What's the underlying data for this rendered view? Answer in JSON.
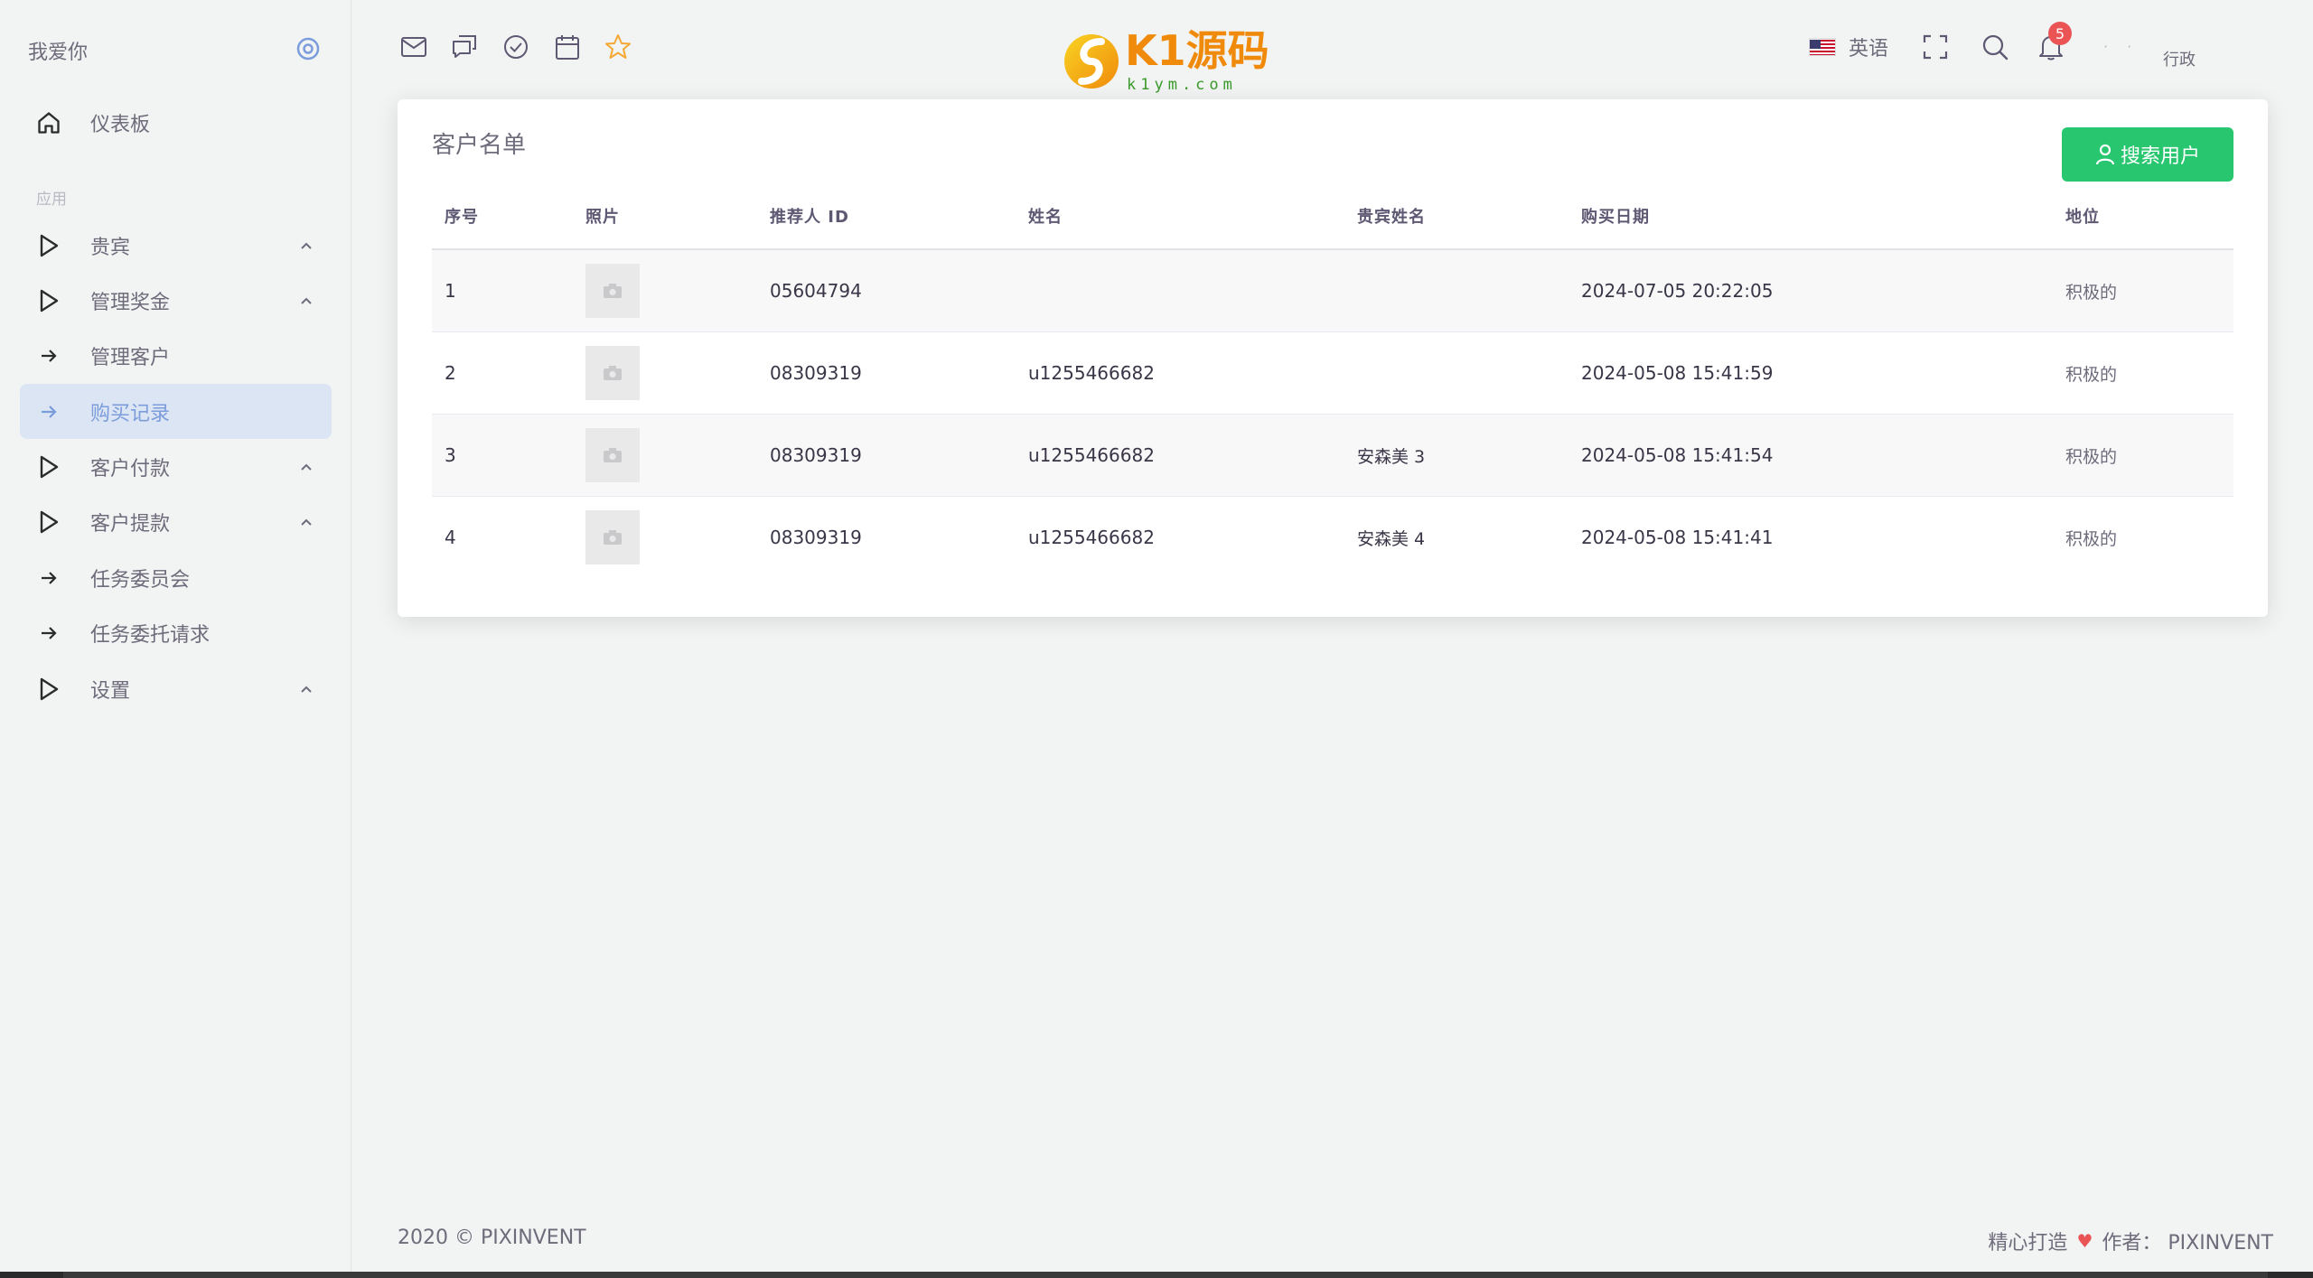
{
  "sidebar": {
    "brand": "我爱你",
    "section_label": "应用",
    "items": [
      {
        "label": "仪表板",
        "icon": "home-icon",
        "chevron": false,
        "active": false
      },
      {
        "label": "贵宾",
        "icon": "play-icon",
        "chevron": true,
        "active": false
      },
      {
        "label": "管理奖金",
        "icon": "play-icon",
        "chevron": true,
        "active": false
      },
      {
        "label": "管理客户",
        "icon": "arrow-right-icon",
        "chevron": false,
        "active": false
      },
      {
        "label": "购买记录",
        "icon": "arrow-right-icon",
        "chevron": false,
        "active": true
      },
      {
        "label": "客户付款",
        "icon": "play-icon",
        "chevron": true,
        "active": false
      },
      {
        "label": "客户提款",
        "icon": "play-icon",
        "chevron": true,
        "active": false
      },
      {
        "label": "任务委员会",
        "icon": "arrow-right-icon",
        "chevron": false,
        "active": false
      },
      {
        "label": "任务委托请求",
        "icon": "arrow-right-icon",
        "chevron": false,
        "active": false
      },
      {
        "label": "设置",
        "icon": "play-icon",
        "chevron": true,
        "active": false
      }
    ]
  },
  "topbar": {
    "icons": [
      "mail-icon",
      "chat-icon",
      "check-circle-icon",
      "calendar-icon",
      "star-icon"
    ],
    "logo": {
      "main": "K1源码",
      "sub": "k1ym.com"
    },
    "language": "英语",
    "notification_count": "5",
    "user_role": "行政",
    "user_dots": "· ·"
  },
  "card": {
    "title": "客户名单",
    "search_button": "搜索用户",
    "columns": [
      "序号",
      "照片",
      "推荐人 ID",
      "姓名",
      "贵宾姓名",
      "购买日期",
      "地位"
    ],
    "rows": [
      {
        "no": "1",
        "referrer_id": "05604794",
        "name": "",
        "vip_name": "",
        "date": "2024-07-05 20:22:05",
        "status": "积极的"
      },
      {
        "no": "2",
        "referrer_id": "08309319",
        "name": "u1255466682",
        "vip_name": "",
        "date": "2024-05-08 15:41:59",
        "status": "积极的"
      },
      {
        "no": "3",
        "referrer_id": "08309319",
        "name": "u1255466682",
        "vip_name": "安森美 3",
        "date": "2024-05-08 15:41:54",
        "status": "积极的"
      },
      {
        "no": "4",
        "referrer_id": "08309319",
        "name": "u1255466682",
        "vip_name": "安森美 4",
        "date": "2024-05-08 15:41:41",
        "status": "积极的"
      }
    ]
  },
  "footer": {
    "left": "2020 © PIXINVENT",
    "right_prefix": "精心打造",
    "right_suffix": "作者： PIXINVENT"
  },
  "colors": {
    "accent": "#7b9ddc",
    "active_bg": "#dce5f3",
    "success": "#28c76f",
    "danger": "#ea5455",
    "star": "#f3a833"
  }
}
